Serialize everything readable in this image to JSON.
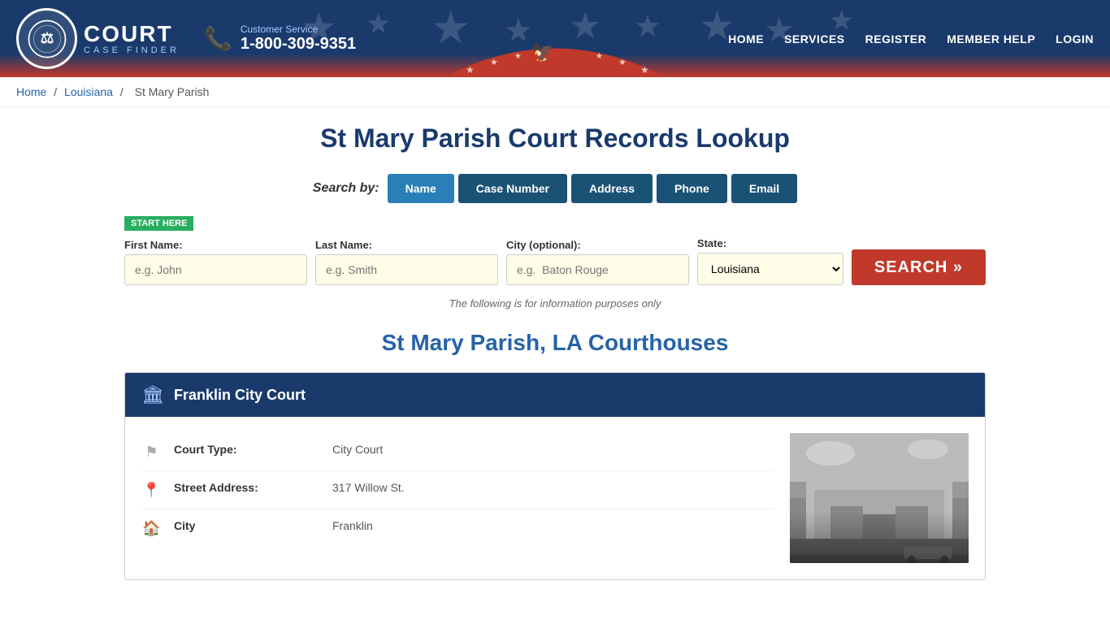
{
  "header": {
    "logo_court": "COURT",
    "logo_case_finder": "CASE FINDER",
    "cs_label": "Customer Service",
    "cs_phone": "1-800-309-9351",
    "nav": {
      "home": "HOME",
      "services": "SERVICES",
      "register": "REGISTER",
      "member_help": "MEMBER HELP",
      "login": "LOGIN"
    }
  },
  "breadcrumb": {
    "home": "Home",
    "state": "Louisiana",
    "current": "St Mary Parish"
  },
  "main": {
    "page_title": "St Mary Parish Court Records Lookup",
    "search_by_label": "Search by:",
    "tabs": [
      {
        "id": "name",
        "label": "Name",
        "active": true
      },
      {
        "id": "case-number",
        "label": "Case Number",
        "active": false
      },
      {
        "id": "address",
        "label": "Address",
        "active": false
      },
      {
        "id": "phone",
        "label": "Phone",
        "active": false
      },
      {
        "id": "email",
        "label": "Email",
        "active": false
      }
    ],
    "start_here": "START HERE",
    "form": {
      "first_name_label": "First Name:",
      "first_name_placeholder": "e.g. John",
      "last_name_label": "Last Name:",
      "last_name_placeholder": "e.g. Smith",
      "city_label": "City (optional):",
      "city_placeholder": "e.g.  Baton Rouge",
      "state_label": "State:",
      "state_value": "Louisiana",
      "search_btn": "SEARCH »"
    },
    "disclaimer": "The following is for information purposes only",
    "courthouses_title": "St Mary Parish, LA Courthouses",
    "courthouses": [
      {
        "name": "Franklin City Court",
        "court_type_label": "Court Type:",
        "court_type_value": "City Court",
        "street_address_label": "Street Address:",
        "street_address_value": "317 Willow St.",
        "city_label": "City",
        "city_value": "Franklin"
      }
    ]
  }
}
